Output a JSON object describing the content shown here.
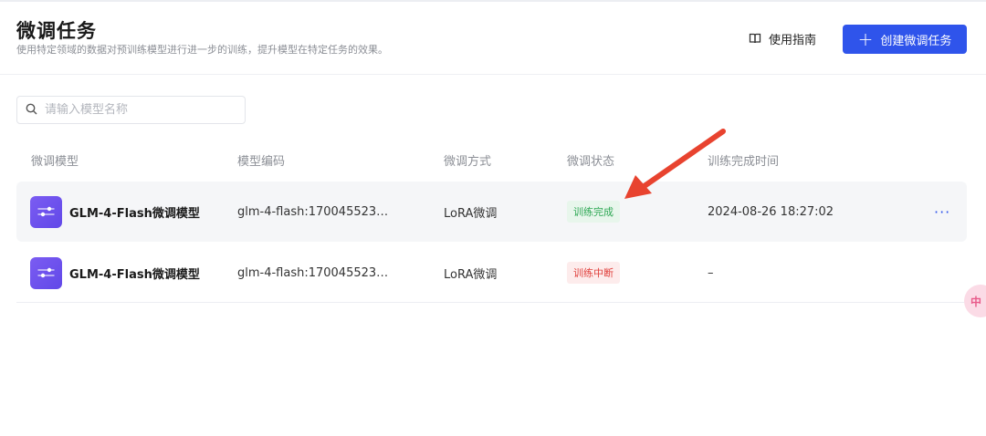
{
  "header": {
    "title": "微调任务",
    "subtitle": "使用特定领域的数据对预训练模型进行进一步的训练，提升模型在特定任务的效果。",
    "guide_label": "使用指南",
    "create_label": "创建微调任务"
  },
  "search": {
    "placeholder": "请输入模型名称",
    "value": ""
  },
  "table": {
    "columns": [
      "微调模型",
      "模型编码",
      "微调方式",
      "微调状态",
      "训练完成时间"
    ],
    "rows": [
      {
        "model": "GLM-4-Flash微调模型",
        "code": "glm-4-flash:170045523…",
        "method": "LoRA微调",
        "status": "训练完成",
        "status_type": "success",
        "time": "2024-08-26 18:27:02",
        "more": "···"
      },
      {
        "model": "GLM-4-Flash微调模型",
        "code": "glm-4-flash:170045523…",
        "method": "LoRA微调",
        "status": "训练中断",
        "status_type": "error",
        "time": "–"
      }
    ]
  },
  "float_chip": {
    "label": "中"
  },
  "colors": {
    "accent": "#2f54eb",
    "success_text": "#2fa855",
    "success_bg": "#e8f6ec",
    "error_text": "#e0413d",
    "error_bg": "#fdecec",
    "annotation_arrow": "#e8432f",
    "avatar": "#6a50ee"
  },
  "icons": {
    "guide": "book-icon",
    "create": "plus-icon",
    "search": "search-icon",
    "model": "sliders-icon",
    "more": "more-horizontal-icon"
  }
}
